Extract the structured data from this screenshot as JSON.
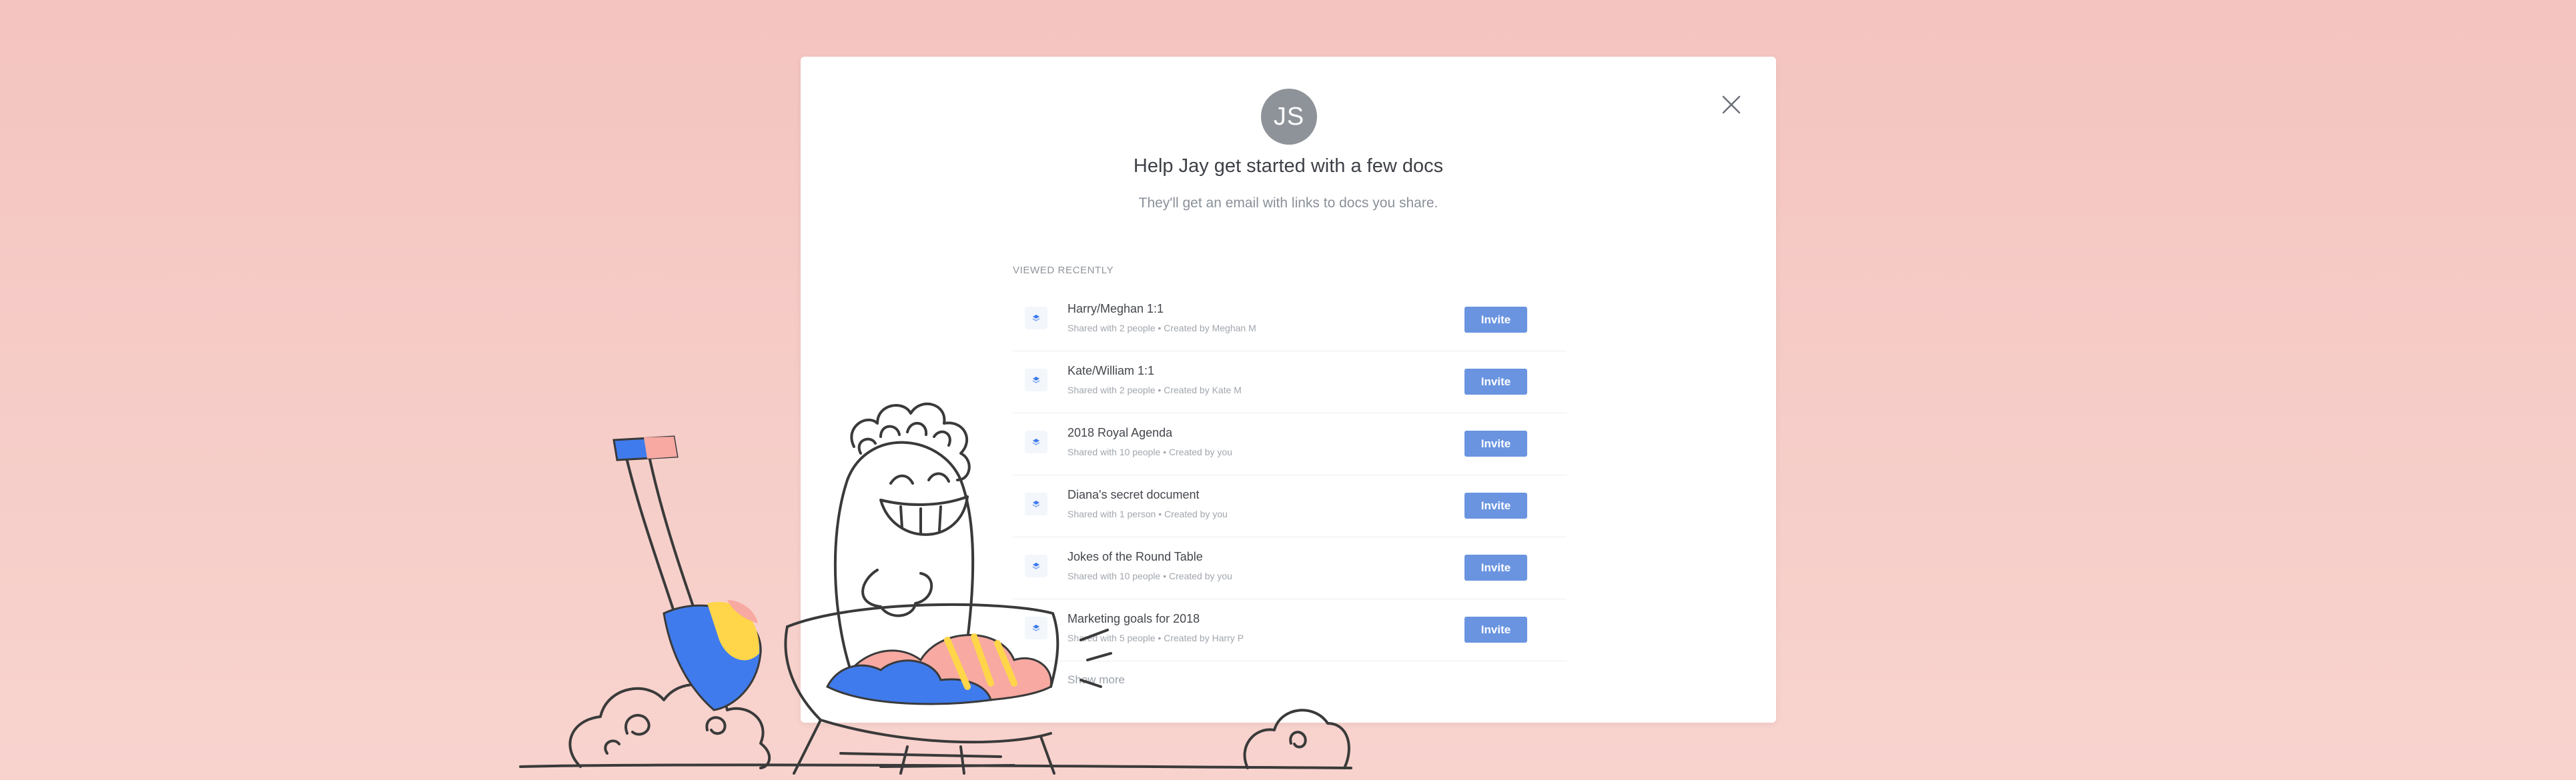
{
  "dialog": {
    "avatar_initials": "JS",
    "title": "Help Jay get started with a few docs",
    "subtitle": "They'll get an email with links to docs you share.",
    "section_label": "VIEWED RECENTLY",
    "show_more": "Show more",
    "invite_label": "Invite",
    "close_icon": "close-icon",
    "docs": [
      {
        "name": "Harry/Meghan 1:1",
        "meta": "Shared with 2 people • Created by Meghan M",
        "icon": "document-icon"
      },
      {
        "name": "Kate/William 1:1",
        "meta": "Shared with 2 people • Created by Kate M",
        "icon": "document-icon"
      },
      {
        "name": "2018 Royal Agenda",
        "meta": "Shared with 10 people • Created by you",
        "icon": "document-icon"
      },
      {
        "name": "Diana's secret document",
        "meta": "Shared with 1 person • Created by you",
        "icon": "document-icon"
      },
      {
        "name": "Jokes of the Round Table",
        "meta": "Shared with 10 people • Created by you",
        "icon": "document-icon"
      },
      {
        "name": "Marketing goals for 2018",
        "meta": "Shared with 5 people • Created by Harry P",
        "icon": "document-icon"
      }
    ]
  },
  "colors": {
    "background": "#f4c4c0",
    "accent": "#6a94e0",
    "avatar": "#8e9299"
  }
}
